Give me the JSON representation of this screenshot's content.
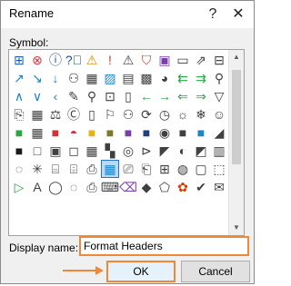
{
  "dialog": {
    "title": "Rename",
    "help_label": "?",
    "close_label": "✕"
  },
  "symbols": {
    "label": "Symbol:",
    "selected_index": 77,
    "items": [
      {
        "name": "sitemap-icon",
        "glyph": "⊞",
        "color": "#1f5fa8"
      },
      {
        "name": "error-icon",
        "glyph": "⊗",
        "color": "#d13438"
      },
      {
        "name": "info-icon",
        "glyph": "ⓘ",
        "color": "#1f4f8f"
      },
      {
        "name": "help-icon",
        "glyph": "?⃝",
        "color": "#1f4f8f"
      },
      {
        "name": "warning-icon",
        "glyph": "⚠",
        "color": "#d88a00"
      },
      {
        "name": "alert-icon",
        "glyph": "!",
        "color": "#d13438"
      },
      {
        "name": "warning-outline-icon",
        "glyph": "⚠",
        "color": "#404040"
      },
      {
        "name": "shield-icon",
        "glyph": "⛉",
        "color": "#d13438"
      },
      {
        "name": "save-icon",
        "glyph": "▣",
        "color": "#7a3ea8"
      },
      {
        "name": "document-icon",
        "glyph": "▭",
        "color": "#404040"
      },
      {
        "name": "share-icon",
        "glyph": "⇗",
        "color": "#404040"
      },
      {
        "name": "hierarchy-icon",
        "glyph": "⊟",
        "color": "#404040"
      },
      {
        "name": "arrow-up-right-icon",
        "glyph": "↗",
        "color": "#1c86c8"
      },
      {
        "name": "arrow-down-right-icon",
        "glyph": "↘",
        "color": "#1c86c8"
      },
      {
        "name": "arrow-down-icon",
        "glyph": "↓",
        "color": "#1c86c8"
      },
      {
        "name": "people-icon",
        "glyph": "⚇",
        "color": "#404040"
      },
      {
        "name": "ruler-icon",
        "glyph": "▦",
        "color": "#404040"
      },
      {
        "name": "image-icon",
        "glyph": "▨",
        "color": "#1c86c8"
      },
      {
        "name": "picture-icon",
        "glyph": "▤",
        "color": "#404040"
      },
      {
        "name": "photos-icon",
        "glyph": "▩",
        "color": "#404040"
      },
      {
        "name": "palette-icon",
        "glyph": "◕",
        "color": "#404040"
      },
      {
        "name": "arrows-left-icon",
        "glyph": "⇇",
        "color": "#2aa745"
      },
      {
        "name": "arrows-right-icon",
        "glyph": "⇉",
        "color": "#2aa745"
      },
      {
        "name": "filter-icon",
        "glyph": "⚲",
        "color": "#404040"
      },
      {
        "name": "chevron-up-icon",
        "glyph": "∧",
        "color": "#1c86c8"
      },
      {
        "name": "chevron-down-icon",
        "glyph": "∨",
        "color": "#1c86c8"
      },
      {
        "name": "chevron-left-icon",
        "glyph": "‹",
        "color": "#1c86c8"
      },
      {
        "name": "pin-icon",
        "glyph": "✎",
        "color": "#404040"
      },
      {
        "name": "pushpin-icon",
        "glyph": "⚲",
        "color": "#404040"
      },
      {
        "name": "flowchart-icon",
        "glyph": "⊡",
        "color": "#404040"
      },
      {
        "name": "text-box-icon",
        "glyph": "▯",
        "color": "#404040"
      },
      {
        "name": "arrow-left-icon",
        "glyph": "←",
        "color": "#2aa745"
      },
      {
        "name": "arrow-right-icon",
        "glyph": "→",
        "color": "#2aa745"
      },
      {
        "name": "arrow-back-icon",
        "glyph": "⇐",
        "color": "#2aa745"
      },
      {
        "name": "arrow-forward-icon",
        "glyph": "⇒",
        "color": "#2aa745"
      },
      {
        "name": "funnel-icon",
        "glyph": "▽",
        "color": "#404040"
      },
      {
        "name": "paste-icon",
        "glyph": "⎘",
        "color": "#404040"
      },
      {
        "name": "calculator-icon",
        "glyph": "▦",
        "color": "#404040"
      },
      {
        "name": "balance-icon",
        "glyph": "⚖",
        "color": "#404040"
      },
      {
        "name": "copyright-icon",
        "glyph": "Ⓒ",
        "color": "#404040"
      },
      {
        "name": "mobile-icon",
        "glyph": "▯",
        "color": "#404040"
      },
      {
        "name": "ribbon-icon",
        "glyph": "⚐",
        "color": "#404040"
      },
      {
        "name": "person-icon",
        "glyph": "⚇",
        "color": "#404040"
      },
      {
        "name": "refresh-icon",
        "glyph": "⟳",
        "color": "#404040"
      },
      {
        "name": "time-icon",
        "glyph": "◷",
        "color": "#404040"
      },
      {
        "name": "sun-icon",
        "glyph": "☼",
        "color": "#404040"
      },
      {
        "name": "snowflake-icon",
        "glyph": "❄",
        "color": "#404040"
      },
      {
        "name": "smile-icon",
        "glyph": "☺",
        "color": "#404040"
      },
      {
        "name": "green-square-icon",
        "glyph": "■",
        "color": "#2aa745"
      },
      {
        "name": "table-icon",
        "glyph": "▦",
        "color": "#404040"
      },
      {
        "name": "red-square-icon",
        "glyph": "■",
        "color": "#d13438"
      },
      {
        "name": "piggy-bank-icon",
        "glyph": "◓",
        "color": "#d13438"
      },
      {
        "name": "yellow-square-icon",
        "glyph": "■",
        "color": "#e7b416"
      },
      {
        "name": "olive-square-icon",
        "glyph": "■",
        "color": "#7a7a2a"
      },
      {
        "name": "purple-square-icon",
        "glyph": "■",
        "color": "#7a3ea8"
      },
      {
        "name": "dark-blue-square-icon",
        "glyph": "■",
        "color": "#1f3f7f"
      },
      {
        "name": "eye-icon",
        "glyph": "◉",
        "color": "#404040"
      },
      {
        "name": "dark-square-icon",
        "glyph": "■",
        "color": "#404040"
      },
      {
        "name": "blue-square-icon",
        "glyph": "■",
        "color": "#1c86c8"
      },
      {
        "name": "triangle-icon",
        "glyph": "◢",
        "color": "#404040"
      },
      {
        "name": "black-square-icon",
        "glyph": "■",
        "color": "#1a1a1a"
      },
      {
        "name": "square-outline-icon",
        "glyph": "□",
        "color": "#404040"
      },
      {
        "name": "frame-icon",
        "glyph": "▣",
        "color": "#404040"
      },
      {
        "name": "box-icon",
        "glyph": "◻",
        "color": "#404040"
      },
      {
        "name": "grid-icon",
        "glyph": "▦",
        "color": "#404040"
      },
      {
        "name": "checker-icon",
        "glyph": "▚",
        "color": "#404040"
      },
      {
        "name": "target-icon",
        "glyph": "◎",
        "color": "#404040"
      },
      {
        "name": "play-circle-icon",
        "glyph": "⊳",
        "color": "#404040"
      },
      {
        "name": "slope-icon",
        "glyph": "◤",
        "color": "#404040"
      },
      {
        "name": "contrast-icon",
        "glyph": "◐",
        "color": "#404040"
      },
      {
        "name": "half-square-icon",
        "glyph": "◩",
        "color": "#404040"
      },
      {
        "name": "bars-icon",
        "glyph": "▥",
        "color": "#404040"
      },
      {
        "name": "chat-icon",
        "glyph": "◌",
        "color": "#404040"
      },
      {
        "name": "spider-icon",
        "glyph": "✳",
        "color": "#404040"
      },
      {
        "name": "cylinder-icon",
        "glyph": "⌸",
        "color": "#404040"
      },
      {
        "name": "database-icon",
        "glyph": "⌹",
        "color": "#404040"
      },
      {
        "name": "documents-icon",
        "glyph": "⎙",
        "color": "#404040"
      },
      {
        "name": "table-filled-icon",
        "glyph": "▦",
        "color": "#1c86c8"
      },
      {
        "name": "stack-icon",
        "glyph": "⎚",
        "color": "#404040"
      },
      {
        "name": "pages-icon",
        "glyph": "⎗",
        "color": "#404040"
      },
      {
        "name": "chart-icon",
        "glyph": "⊞",
        "color": "#404040"
      },
      {
        "name": "globe-icon",
        "glyph": "◍",
        "color": "#404040"
      },
      {
        "name": "frame-outline-icon",
        "glyph": "▢",
        "color": "#404040"
      },
      {
        "name": "cube-icon",
        "glyph": "⬚",
        "color": "#404040"
      },
      {
        "name": "play-icon",
        "glyph": "▷",
        "color": "#2aa745"
      },
      {
        "name": "letter-a-icon",
        "glyph": "A",
        "color": "#404040"
      },
      {
        "name": "sphere-icon",
        "glyph": "◯",
        "color": "#404040"
      },
      {
        "name": "dotted-circle-icon",
        "glyph": "◌",
        "color": "#404040"
      },
      {
        "name": "print-icon",
        "glyph": "⎙",
        "color": "#404040"
      },
      {
        "name": "code-icon",
        "glyph": "⌨",
        "color": "#404040"
      },
      {
        "name": "eraser-icon",
        "glyph": "⌫",
        "color": "#7a3ea8"
      },
      {
        "name": "diamond-icon",
        "glyph": "◆",
        "color": "#404040"
      },
      {
        "name": "shapes-icon",
        "glyph": "⬠",
        "color": "#404040"
      },
      {
        "name": "office-icon",
        "glyph": "✿",
        "color": "#d83b01"
      },
      {
        "name": "check-icon",
        "glyph": "✔",
        "color": "#404040"
      },
      {
        "name": "mail-icon",
        "glyph": "✉",
        "color": "#404040"
      }
    ]
  },
  "display_name": {
    "label": "Display name:",
    "value": "Format Headers"
  },
  "buttons": {
    "ok_label": "OK",
    "cancel_label": "Cancel"
  },
  "colors": {
    "highlight": "#f0883a",
    "selection_border": "#1e75d2"
  }
}
